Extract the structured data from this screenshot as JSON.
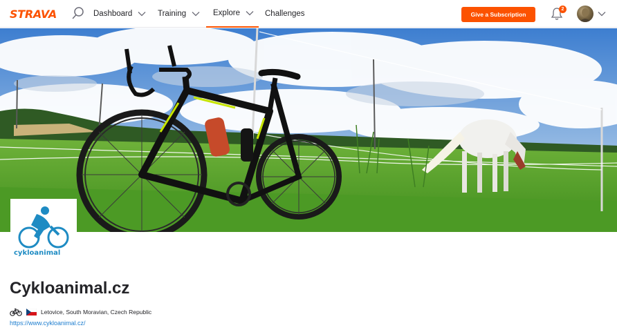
{
  "nav": {
    "logo": "STRAVA",
    "items": [
      {
        "label": "Dashboard",
        "has_dropdown": true,
        "active": false
      },
      {
        "label": "Training",
        "has_dropdown": true,
        "active": false
      },
      {
        "label": "Explore",
        "has_dropdown": true,
        "active": true
      },
      {
        "label": "Challenges",
        "has_dropdown": false,
        "active": false
      }
    ],
    "subscription_button": "Give a Subscription",
    "notification_count": "2"
  },
  "club": {
    "logo_text": "cykloanimal",
    "name": "Cykloanimal.cz",
    "sport_icon": "bicycle-icon",
    "country_flag": "czech-flag-icon",
    "location": "Letovice, South Moravian, Czech Republic",
    "website": "https://www.cykloanimal.cz/"
  },
  "colors": {
    "brand": "#fc5200",
    "link": "#1e7ecf",
    "club_logo_blue": "#1e8bc3"
  }
}
